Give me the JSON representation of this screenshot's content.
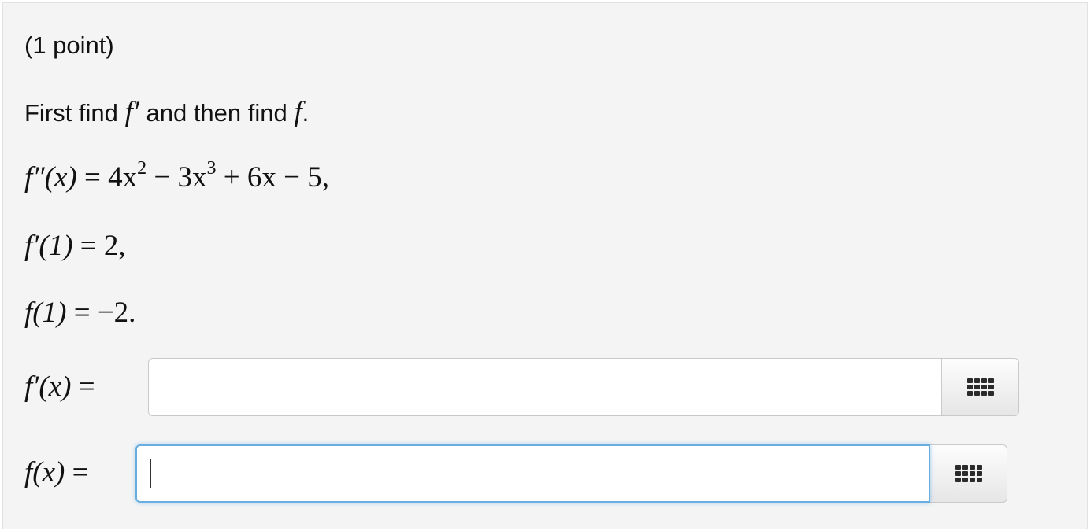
{
  "problem": {
    "points": "(1 point)",
    "instruction": {
      "prefix": "First find",
      "f_prime": "f′",
      "middle": "and then find",
      "f": "f",
      "suffix": "."
    },
    "given": [
      {
        "lhs": "f″(x)",
        "rhs_parts": [
          "4x",
          "2",
          " − 3x",
          "3",
          " + 6x − 5,"
        ]
      },
      {
        "lhs": "f′(1)",
        "rhs": "2,"
      },
      {
        "lhs": "f(1)",
        "rhs": "−2."
      }
    ]
  },
  "answers": [
    {
      "label": "f′(x)",
      "value": "",
      "focused": false,
      "palette_icon": "grid-icon"
    },
    {
      "label": "f(x)",
      "value": "",
      "focused": true,
      "palette_icon": "grid-icon"
    }
  ],
  "colors": {
    "panel_bg": "#f4f4f4",
    "focus_border": "#6aaee0"
  }
}
